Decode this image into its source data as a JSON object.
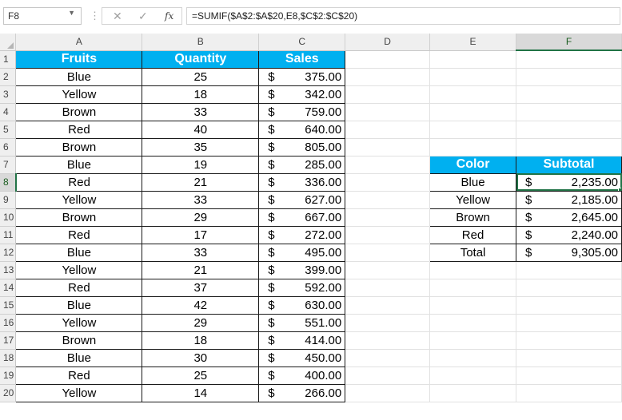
{
  "formula_bar": {
    "name_box": "F8",
    "cancel_icon": "✕",
    "enter_icon": "✓",
    "fx_label": "fx",
    "formula": "=SUMIF($A$2:$A$20,E8,$C$2:$C$20)"
  },
  "columns": [
    "A",
    "B",
    "C",
    "D",
    "E",
    "F"
  ],
  "rows": [
    "1",
    "2",
    "3",
    "4",
    "5",
    "6",
    "7",
    "8",
    "9",
    "10",
    "11",
    "12",
    "13",
    "14",
    "15",
    "16",
    "17",
    "18",
    "19",
    "20"
  ],
  "headers": {
    "fruits": "Fruits",
    "quantity": "Quantity",
    "sales": "Sales"
  },
  "data": [
    {
      "fruit": "Blue",
      "qty": "25",
      "cur": "$",
      "sales": "375.00"
    },
    {
      "fruit": "Yellow",
      "qty": "18",
      "cur": "$",
      "sales": "342.00"
    },
    {
      "fruit": "Brown",
      "qty": "33",
      "cur": "$",
      "sales": "759.00"
    },
    {
      "fruit": "Red",
      "qty": "40",
      "cur": "$",
      "sales": "640.00"
    },
    {
      "fruit": "Brown",
      "qty": "35",
      "cur": "$",
      "sales": "805.00"
    },
    {
      "fruit": "Blue",
      "qty": "19",
      "cur": "$",
      "sales": "285.00"
    },
    {
      "fruit": "Red",
      "qty": "21",
      "cur": "$",
      "sales": "336.00"
    },
    {
      "fruit": "Yellow",
      "qty": "33",
      "cur": "$",
      "sales": "627.00"
    },
    {
      "fruit": "Brown",
      "qty": "29",
      "cur": "$",
      "sales": "667.00"
    },
    {
      "fruit": "Red",
      "qty": "17",
      "cur": "$",
      "sales": "272.00"
    },
    {
      "fruit": "Blue",
      "qty": "33",
      "cur": "$",
      "sales": "495.00"
    },
    {
      "fruit": "Yellow",
      "qty": "21",
      "cur": "$",
      "sales": "399.00"
    },
    {
      "fruit": "Red",
      "qty": "37",
      "cur": "$",
      "sales": "592.00"
    },
    {
      "fruit": "Blue",
      "qty": "42",
      "cur": "$",
      "sales": "630.00"
    },
    {
      "fruit": "Yellow",
      "qty": "29",
      "cur": "$",
      "sales": "551.00"
    },
    {
      "fruit": "Brown",
      "qty": "18",
      "cur": "$",
      "sales": "414.00"
    },
    {
      "fruit": "Blue",
      "qty": "30",
      "cur": "$",
      "sales": "450.00"
    },
    {
      "fruit": "Red",
      "qty": "25",
      "cur": "$",
      "sales": "400.00"
    },
    {
      "fruit": "Yellow",
      "qty": "14",
      "cur": "$",
      "sales": "266.00"
    }
  ],
  "summary": {
    "header_color": "Color",
    "header_subtotal": "Subtotal",
    "rows": [
      {
        "color": "Blue",
        "cur": "$",
        "subtotal": "2,235.00"
      },
      {
        "color": "Yellow",
        "cur": "$",
        "subtotal": "2,185.00"
      },
      {
        "color": "Brown",
        "cur": "$",
        "subtotal": "2,645.00"
      },
      {
        "color": "Red",
        "cur": "$",
        "subtotal": "2,240.00"
      },
      {
        "color": "Total",
        "cur": "$",
        "subtotal": "9,305.00"
      }
    ]
  },
  "colors": {
    "header_fill": "#00b0f0",
    "selection": "#217346"
  }
}
